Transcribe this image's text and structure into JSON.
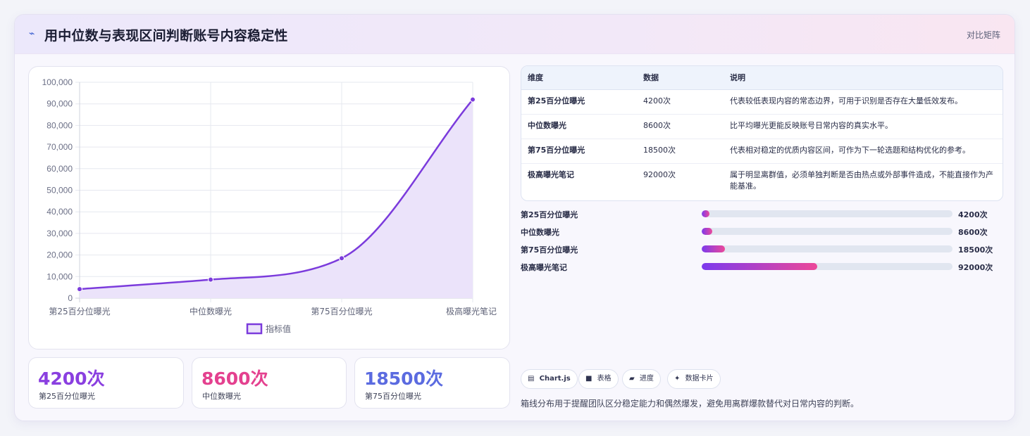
{
  "header": {
    "icon": "zigzag-icon",
    "icon_glyph": "⌁",
    "title": "用中位数与表现区间判断账号内容稳定性",
    "right_label": "对比矩阵"
  },
  "chart_data": {
    "type": "line",
    "categories": [
      "第25百分位曝光",
      "中位数曝光",
      "第75百分位曝光",
      "极高曝光笔记"
    ],
    "series": [
      {
        "name": "指标值",
        "values": [
          4200,
          8600,
          18500,
          92000
        ],
        "color": "#7b3bdc",
        "fill": "#ebe3fa"
      }
    ],
    "y_ticks": [
      "0",
      "10,000",
      "20,000",
      "30,000",
      "40,000",
      "50,000",
      "60,000",
      "70,000",
      "80,000",
      "90,000",
      "100,000"
    ],
    "ylim": [
      0,
      100000
    ],
    "grid": true,
    "legend": "bottom",
    "smooth": true
  },
  "stats": [
    {
      "value": "4200次",
      "label": "第25百分位曝光",
      "color": "#8a3fe0"
    },
    {
      "value": "8600次",
      "label": "中位数曝光",
      "color": "#e4418f"
    },
    {
      "value": "18500次",
      "label": "第75百分位曝光",
      "color": "#5b6be0"
    }
  ],
  "table": {
    "headers": [
      "维度",
      "数据",
      "说明"
    ],
    "rows": [
      {
        "dim": "第25百分位曝光",
        "data": "4200次",
        "desc": "代表较低表现内容的常态边界，可用于识别是否存在大量低效发布。"
      },
      {
        "dim": "中位数曝光",
        "data": "8600次",
        "desc": "比平均曝光更能反映账号日常内容的真实水平。"
      },
      {
        "dim": "第75百分位曝光",
        "data": "18500次",
        "desc": "代表相对稳定的优质内容区间，可作为下一轮选题和结构优化的参考。"
      },
      {
        "dim": "极高曝光笔记",
        "data": "92000次",
        "desc": "属于明显离群值，必须单独判断是否由热点或外部事件造成，不能直接作为产能基准。"
      }
    ]
  },
  "progress": {
    "max": 200000,
    "items": [
      {
        "label": "第25百分位曝光",
        "value": 4200,
        "value_text": "4200次"
      },
      {
        "label": "中位数曝光",
        "value": 8600,
        "value_text": "8600次"
      },
      {
        "label": "第75百分位曝光",
        "value": 18500,
        "value_text": "18500次"
      },
      {
        "label": "极高曝光笔记",
        "value": 92000,
        "value_text": "92000次"
      }
    ]
  },
  "chips": [
    {
      "icon": "chart-icon",
      "glyph": "▤",
      "label": "Chart.js"
    },
    {
      "icon": "table-icon",
      "glyph": "■",
      "label": "表格"
    },
    {
      "icon": "progress-icon",
      "glyph": "▰",
      "label": "进度"
    },
    {
      "icon": "sparkle-icon",
      "glyph": "✦",
      "label": "数据卡片"
    }
  ],
  "footer_note": "箱线分布用于提醒团队区分稳定能力和偶然爆发，避免用离群爆款替代对日常内容的判断。"
}
